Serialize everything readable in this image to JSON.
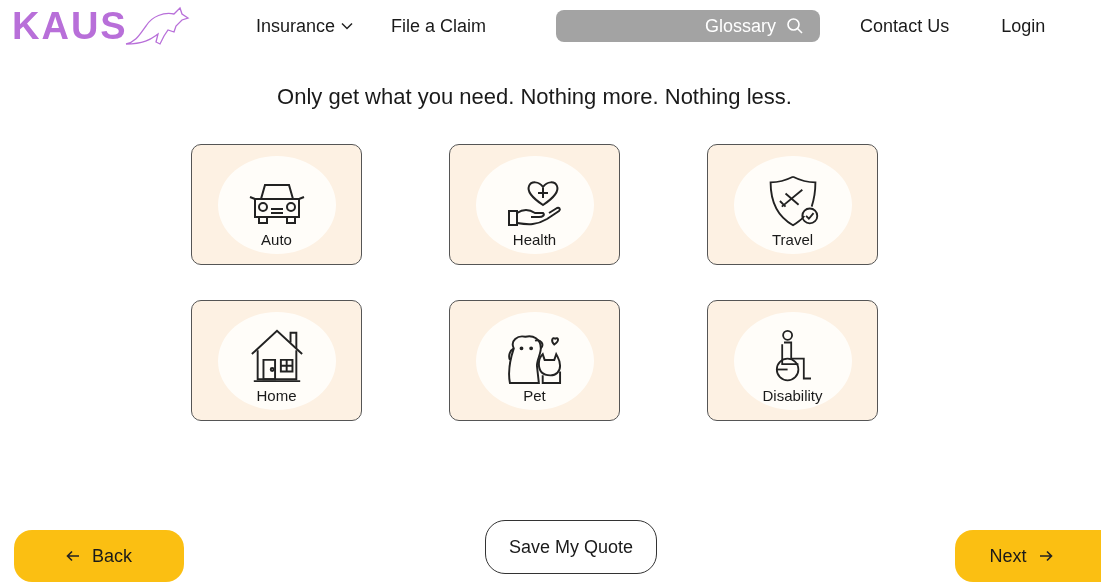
{
  "logo": {
    "text": "KAUS"
  },
  "nav": [
    {
      "label": "Insurance",
      "kind": "dropdown"
    },
    {
      "label": "File a Claim",
      "kind": "link"
    }
  ],
  "search": {
    "placeholder": "Glossary"
  },
  "nav_right": [
    {
      "label": "Contact Us"
    },
    {
      "label": "Login"
    }
  ],
  "heading": "Only get what you need. Nothing more. Nothing less.",
  "options": [
    {
      "label": "Auto",
      "kind": "car"
    },
    {
      "label": "Health",
      "kind": "health"
    },
    {
      "label": "Travel",
      "kind": "travel"
    },
    {
      "label": "Home",
      "kind": "home"
    },
    {
      "label": "Pet",
      "kind": "pet"
    },
    {
      "label": "Disability",
      "kind": "wheelchair"
    }
  ],
  "buttons": {
    "back": "Back",
    "save": "Save My Quote",
    "next": "Next"
  }
}
